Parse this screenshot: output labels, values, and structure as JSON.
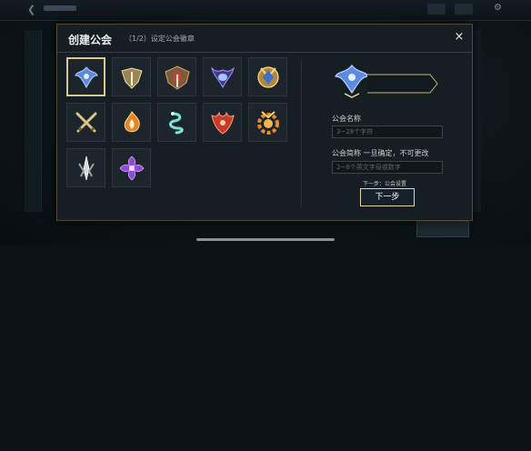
{
  "dialog": {
    "title": "创建公会",
    "step": "（1/2）设定公会徽章",
    "close_label": "×"
  },
  "emblems": [
    {
      "icon": "blue-winged-emblem-icon",
      "selected": true
    },
    {
      "icon": "gold-wing-crest-icon",
      "selected": false
    },
    {
      "icon": "bronze-shield-crest-icon",
      "selected": false
    },
    {
      "icon": "purple-horned-crest-icon",
      "selected": false
    },
    {
      "icon": "gold-blue-crest-icon",
      "selected": false
    },
    {
      "icon": "crossed-swords-icon",
      "selected": false
    },
    {
      "icon": "orange-flame-icon",
      "selected": false
    },
    {
      "icon": "teal-serpent-icon",
      "selected": false
    },
    {
      "icon": "red-flame-crest-icon",
      "selected": false
    },
    {
      "icon": "orange-gear-crest-icon",
      "selected": false
    },
    {
      "icon": "silver-blade-icon",
      "selected": false
    },
    {
      "icon": "purple-shuriken-icon",
      "selected": false
    }
  ],
  "form": {
    "name_label": "公会名称",
    "name_placeholder": "3~28个字符",
    "short_label": "公会简称  一旦确定，不可更改",
    "short_placeholder": "2~6个英文字母或数字",
    "hint": "下一步：公会设置",
    "next_label": "下一步"
  },
  "colors": {
    "accent_gold": "#d8c78e",
    "dialog_bg": "#151e23"
  }
}
